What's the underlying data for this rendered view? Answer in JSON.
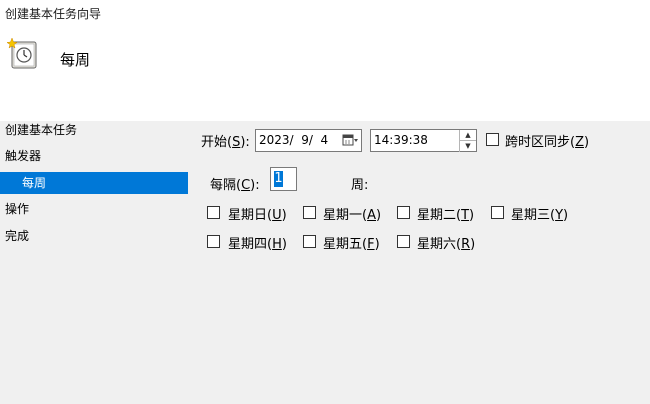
{
  "window": {
    "title": "创建基本任务向导"
  },
  "header": {
    "icon": "task-wizard-icon",
    "title": "每周"
  },
  "nav": {
    "items": [
      {
        "label": "创建基本任务",
        "selected": false
      },
      {
        "label": "触发器",
        "selected": false
      },
      {
        "label": "每周",
        "selected": true
      },
      {
        "label": "操作",
        "selected": false
      },
      {
        "label": "完成",
        "selected": false
      }
    ]
  },
  "form": {
    "start_label": "开始(S):",
    "start_label_main": "开始(",
    "start_key": "S",
    "start_label_end": "):",
    "date_value": "2023/  9/  4",
    "time_value": "14:39:38",
    "sync_label": "跨时区同步(Z)",
    "sync_main": "跨时区同步(",
    "sync_key": "Z",
    "sync_end": ")",
    "sync_checked": false,
    "recur_label_main": "每隔(",
    "recur_key": "C",
    "recur_end": "):",
    "recur_value": "1",
    "weeks_label": "周:",
    "days": [
      {
        "label": "星期日",
        "key": "U",
        "checked": false
      },
      {
        "label": "星期一",
        "key": "A",
        "checked": false
      },
      {
        "label": "星期二",
        "key": "T",
        "checked": false
      },
      {
        "label": "星期三",
        "key": "Y",
        "checked": false
      },
      {
        "label": "星期四",
        "key": "H",
        "checked": false
      },
      {
        "label": "星期五",
        "key": "F",
        "checked": false
      },
      {
        "label": "星期六",
        "key": "R",
        "checked": false
      }
    ]
  },
  "colors": {
    "selection": "#0078d7",
    "panel": "#f0f0f0"
  }
}
